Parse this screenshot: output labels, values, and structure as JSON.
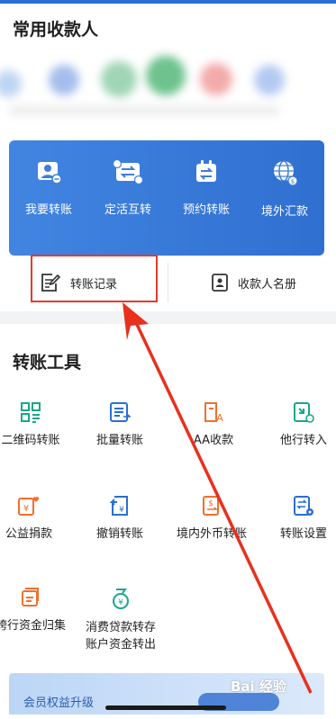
{
  "header": {
    "payees_title": "常用收款人"
  },
  "quick_actions": [
    {
      "label": "我要转账",
      "icon": "transfer-user-icon"
    },
    {
      "label": "定活互转",
      "icon": "exchange-card-icon"
    },
    {
      "label": "预约转账",
      "icon": "calendar-transfer-icon"
    },
    {
      "label": "境外汇款",
      "icon": "globe-dollar-icon"
    }
  ],
  "sub_actions": {
    "record_label": "转账记录",
    "payee_book_label": "收款人名册"
  },
  "tools": {
    "title": "转账工具",
    "items": [
      {
        "label": "二维码转账",
        "icon": "qrcode-icon"
      },
      {
        "label": "批量转账",
        "icon": "batch-list-icon"
      },
      {
        "label": "AA收款",
        "icon": "aa-collect-icon"
      },
      {
        "label": "他行转入",
        "icon": "inbound-transfer-icon"
      },
      {
        "label": "公益捐款",
        "icon": "donation-icon"
      },
      {
        "label": "撤销转账",
        "icon": "revoke-transfer-icon"
      },
      {
        "label": "境内外币转账",
        "icon": "foreign-currency-icon"
      },
      {
        "label": "转账设置",
        "icon": "transfer-settings-icon"
      },
      {
        "label": "跨行资金归集",
        "icon": "fund-collect-icon"
      },
      {
        "label": "消费贷款转存",
        "label2": "账户资金转出",
        "icon": "loan-transfer-icon"
      }
    ]
  },
  "banner": {
    "text": "会员权益升级"
  },
  "watermark": {
    "text": "Bai 经验"
  },
  "colors": {
    "accent": "#2f6fd0",
    "orange": "#f0702c",
    "teal": "#18a78c",
    "blue": "#2b6fd0",
    "annotation_red": "#e23d2b"
  }
}
